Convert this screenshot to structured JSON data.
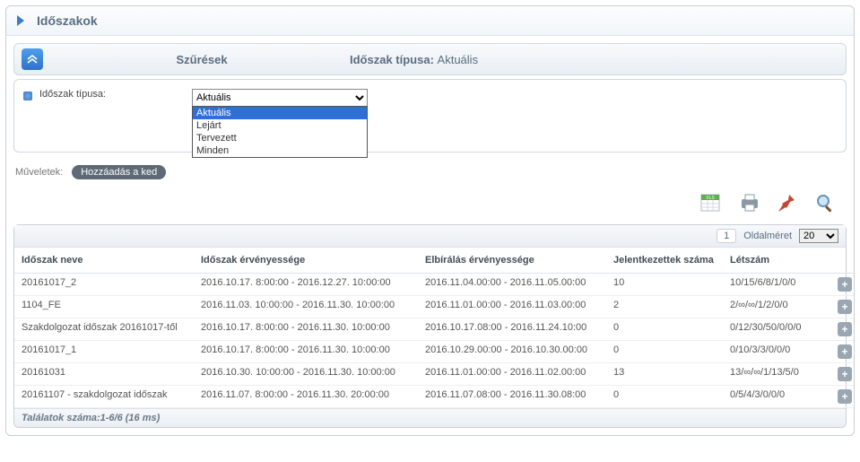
{
  "header": {
    "title": "Időszakok"
  },
  "filter_bar": {
    "left_label": "Szűrések",
    "type_label": "Időszak típusa:",
    "type_value": "Aktuális"
  },
  "filter_form": {
    "field_label": "Időszak típusa:",
    "selected": "Aktuális",
    "options": [
      "Aktuális",
      "Lejárt",
      "Tervezett",
      "Minden"
    ]
  },
  "ops": {
    "label": "Műveletek:",
    "add_button": "Hozzáadás a ked"
  },
  "toolbar": {
    "xls": "XLS"
  },
  "pager": {
    "page": "1",
    "size_label": "Oldalméret",
    "size_value": "20"
  },
  "columns": {
    "name": "Időszak neve",
    "validity": "Időszak érvényessége",
    "eval": "Elbírálás érvényessége",
    "applicants": "Jelentkezettek száma",
    "head": "Létszám"
  },
  "rows": [
    {
      "name": "20161017_2",
      "validity": "2016.10.17. 8:00:00 - 2016.12.27. 10:00:00",
      "eval": "2016.11.04.00:00 - 2016.11.05.00:00",
      "applicants": "10",
      "head": "10/15/6/8/1/0/0"
    },
    {
      "name": "1104_FE",
      "validity": "2016.11.03. 10:00:00 - 2016.11.30. 10:00:00",
      "eval": "2016.11.01.00:00 - 2016.11.03.00:00",
      "applicants": "2",
      "head": "2/∞/∞/1/2/0/0"
    },
    {
      "name": "Szakdolgozat időszak 20161017-től",
      "validity": "2016.10.17. 8:00:00 - 2016.11.30. 10:00:00",
      "eval": "2016.10.17.08:00 - 2016.11.24.10:00",
      "applicants": "0",
      "head": "0/12/30/50/0/0/0"
    },
    {
      "name": "20161017_1",
      "validity": "2016.10.17. 8:00:00 - 2016.11.30. 10:00:00",
      "eval": "2016.10.29.00:00 - 2016.10.30.00:00",
      "applicants": "0",
      "head": "0/10/3/3/0/0/0"
    },
    {
      "name": "20161031",
      "validity": "2016.10.30. 10:00:00 - 2016.11.30. 10:00:00",
      "eval": "2016.11.01.00:00 - 2016.11.02.00:00",
      "applicants": "13",
      "head": "13/∞/∞/1/13/5/0"
    },
    {
      "name": "20161107 - szakdolgozat időszak",
      "validity": "2016.11.07. 8:00:00 - 2016.11.30. 20:00:00",
      "eval": "2016.11.07.08:00 - 2016.11.30.08:00",
      "applicants": "0",
      "head": "0/5/4/3/0/0/0"
    }
  ],
  "footer": {
    "results": "Találatok száma:1-6/6 (16 ms)"
  }
}
